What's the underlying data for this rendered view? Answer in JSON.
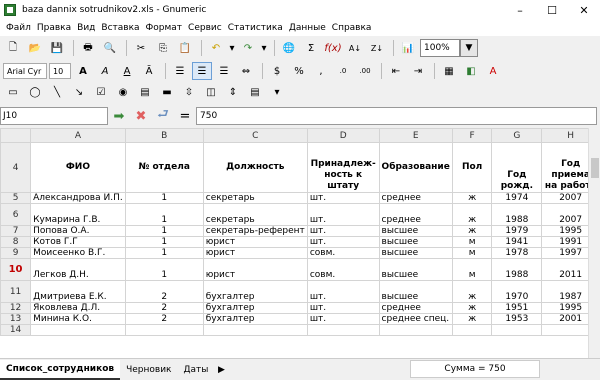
{
  "window": {
    "title": "baza dannix sotrudnikov2.xls - Gnumeric",
    "minimize": "–",
    "maximize": "☐",
    "close": "✕"
  },
  "menu": [
    "Файл",
    "Правка",
    "Вид",
    "Вставка",
    "Формат",
    "Сервис",
    "Статистика",
    "Данные",
    "Справка"
  ],
  "toolbar": {
    "zoom": "100%",
    "font_name": "Arial Cyr",
    "font_size": "10"
  },
  "formula_bar": {
    "cell_ref": "J10",
    "equals": "=",
    "value": "750"
  },
  "columns": [
    "A",
    "B",
    "C",
    "D",
    "E",
    "F",
    "G",
    "H"
  ],
  "header_row": {
    "row_num": "4",
    "cells": [
      "ФИО",
      "№ отдела",
      "Должность",
      "Принадлеж-\nность к штату",
      "Образование",
      "Пол",
      "Год рожд.",
      "Год приема\nна работу"
    ]
  },
  "rows": [
    {
      "num": "5",
      "cells": [
        "Александрова И.П.",
        "1",
        "секретарь",
        "шт.",
        "среднее",
        "ж",
        "1974",
        "2007"
      ]
    },
    {
      "num": "6",
      "cells": [
        "Кумарина Г.В.",
        "1",
        "секретарь",
        "шт.",
        "среднее",
        "ж",
        "1988",
        "2007"
      ]
    },
    {
      "num": "7",
      "cells": [
        "Попова О.А.",
        "1",
        "секретарь-референт",
        "шт.",
        "высшее",
        "ж",
        "1979",
        "1995"
      ]
    },
    {
      "num": "8",
      "cells": [
        "Котов Г.Г",
        "1",
        "юрист",
        "шт.",
        "высшее",
        "м",
        "1941",
        "1991"
      ]
    },
    {
      "num": "9",
      "cells": [
        "Моисеенко В.Г.",
        "1",
        "юрист",
        "совм.",
        "высшее",
        "м",
        "1978",
        "1997"
      ]
    },
    {
      "num": "10",
      "cells": [
        "Легков Д.Н.",
        "1",
        "юрист",
        "совм.",
        "высшее",
        "м",
        "1988",
        "2011"
      ]
    },
    {
      "num": "11",
      "cells": [
        "Дмитриева Е.К.",
        "2",
        "бухгалтер",
        "шт.",
        "высшее",
        "ж",
        "1970",
        "1987"
      ]
    },
    {
      "num": "12",
      "cells": [
        "Яковлева Д.Л.",
        "2",
        "бухгалтер",
        "шт.",
        "среднее",
        "ж",
        "1951",
        "1995"
      ]
    },
    {
      "num": "13",
      "cells": [
        "Минина К.О.",
        "2",
        "бухгалтер",
        "шт.",
        "среднее спец.",
        "ж",
        "1953",
        "2001"
      ]
    },
    {
      "num": "14",
      "cells": [
        "",
        "",
        "",
        "",
        "",
        "",
        "",
        ""
      ]
    }
  ],
  "sheet_tabs": [
    "Список_сотрудников",
    "Черновик",
    "Даты"
  ],
  "status": {
    "sum": "Сумма = 750"
  }
}
